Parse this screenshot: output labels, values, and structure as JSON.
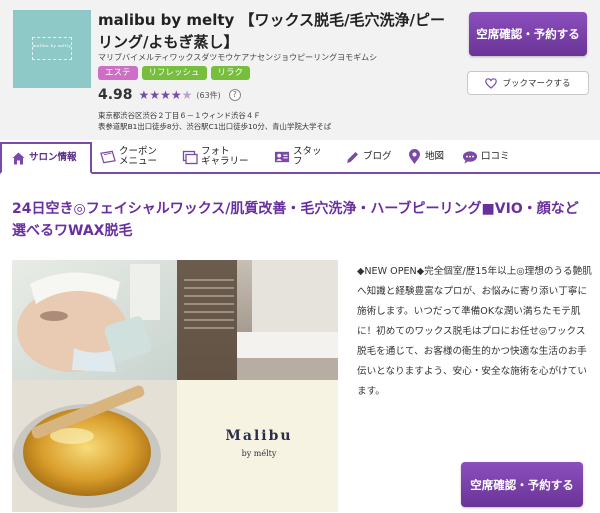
{
  "header": {
    "logo_text": "malibu by mélty",
    "title": "malibu by melty 【ワックス脱毛/毛穴洗浄/ピーリング/よもぎ蒸し】",
    "kana": "マリブバイメルティワックスダツモウケアナセンジョウピーリングヨモギムシ",
    "tags": [
      "エステ",
      "リフレッシュ",
      "リラク"
    ],
    "rating": "4.98",
    "review_count": "(63件)",
    "help_label": "?",
    "stars": "4.5",
    "address_line1": "東京都渋谷区渋谷２丁目６－１ウィンド渋谷４Ｆ",
    "address_line2": "表参道駅B1出口徒歩8分、渋谷駅C1出口徒歩10分、青山学院大学そば",
    "reserve_label": "空席確認・予約する",
    "bookmark_label": "ブックマークする"
  },
  "nav": {
    "tabs": [
      {
        "label": "サロン情報",
        "icon": "home-icon"
      },
      {
        "label": "クーポン\nメニュー",
        "icon": "coupon-icon"
      },
      {
        "label": "フォト\nギャラリー",
        "icon": "photo-icon"
      },
      {
        "label": "スタッフ",
        "icon": "staff-icon"
      },
      {
        "label": "ブログ",
        "icon": "pencil-icon"
      },
      {
        "label": "地図",
        "icon": "map-pin-icon"
      },
      {
        "label": "口コミ",
        "icon": "chat-icon"
      }
    ]
  },
  "main": {
    "catch_copy": "24日空き◎フェイシャルワックス/肌質改善・毛穴洗浄・ハーブピーリング■VIO・顔など選べるワWAX脱毛",
    "brand_name": "Malibu",
    "brand_sub": "by mélty",
    "description": "◆NEW OPEN◆完全個室/歴15年以上◎理想のうる艶肌へ知識と経験豊富なプロが、お悩みに寄り添い丁寧に施術します。いつだって準備OKな潤い満ちたモテ肌に！初めてのワックス脱毛はプロにお任せ◎ワックス脱毛を通じて、お客様の衛生的かつ快適な生活のお手伝いとなりますよう、安心・安全な施術を心がけています。",
    "reserve_label": "空席確認・予約する"
  },
  "colors": {
    "accent": "#7b4aa8",
    "button": "#6a3497",
    "catch": "#6a2f9e",
    "tag_este": "#cd6fc4",
    "tag_green": "#76be3c",
    "logo_bg": "#8ec9c8"
  }
}
